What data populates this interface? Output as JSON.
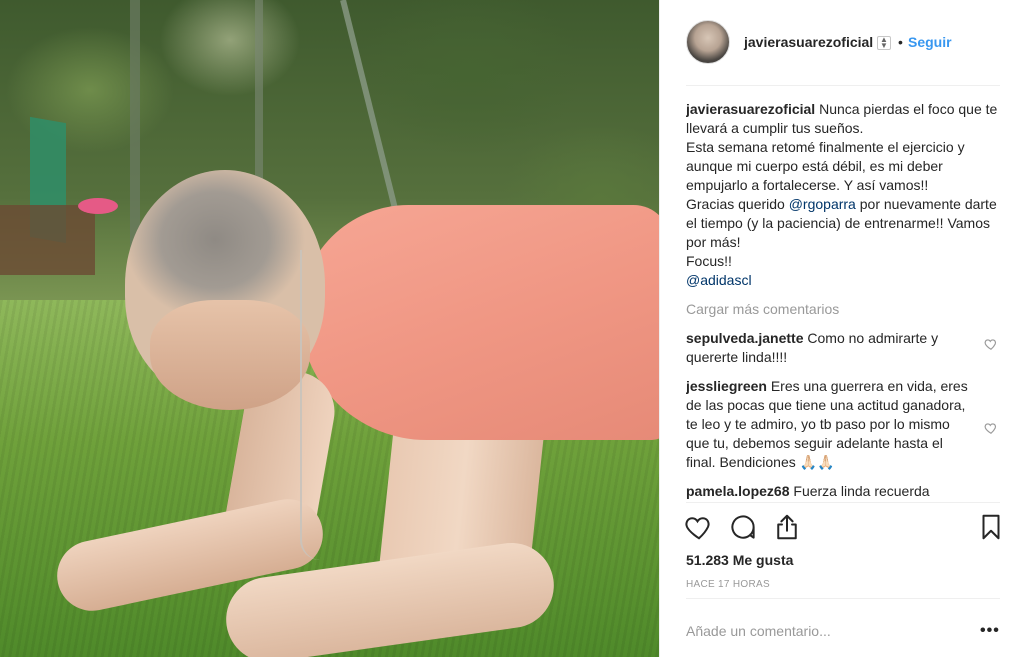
{
  "header": {
    "username": "javierasuarezoficial",
    "dot": "•",
    "follow_label": "Seguir"
  },
  "caption": {
    "username": "javierasuarezoficial",
    "text1": "Nunca pierdas el foco que te llevará a cumplir tus sueños.",
    "text2": "Esta semana retomé finalmente el ejercicio y aunque mi cuerpo está débil, es mi deber empujarlo a fortalecerse. Y así vamos!!",
    "text3_prefix": "Gracias querido ",
    "mention1": "@rgoparra",
    "text3_suffix": " por nuevamente darte el tiempo (y la paciencia) de entrenarme!! Vamos por más!",
    "text4": "Focus!!",
    "mention2": "@adidascl"
  },
  "load_more": "Cargar más comentarios",
  "comments": [
    {
      "username": "sepulveda.janette",
      "text": "Como no admirarte y quererte linda!!!!"
    },
    {
      "username": "jessliegreen",
      "text": "Eres una guerrera en vida, eres de las pocas que tiene una actitud ganadora, te leo y te admiro, yo tb paso por lo mismo que tu, debemos seguir adelante hasta el final. Bendiciones 🙏🏻🙏🏻"
    },
    {
      "username": "pamela.lopez68",
      "text": "Fuerza linda recuerda"
    }
  ],
  "likes": "51.283 Me gusta",
  "timestamp": "HACE 17 HORAS",
  "add_comment_placeholder": "Añade un comentario...",
  "more_label": "•••",
  "icons": {
    "like": "heart-icon",
    "comment": "comment-bubble-icon",
    "share": "share-icon",
    "save": "bookmark-icon",
    "verified": "sort-arrows-icon"
  }
}
